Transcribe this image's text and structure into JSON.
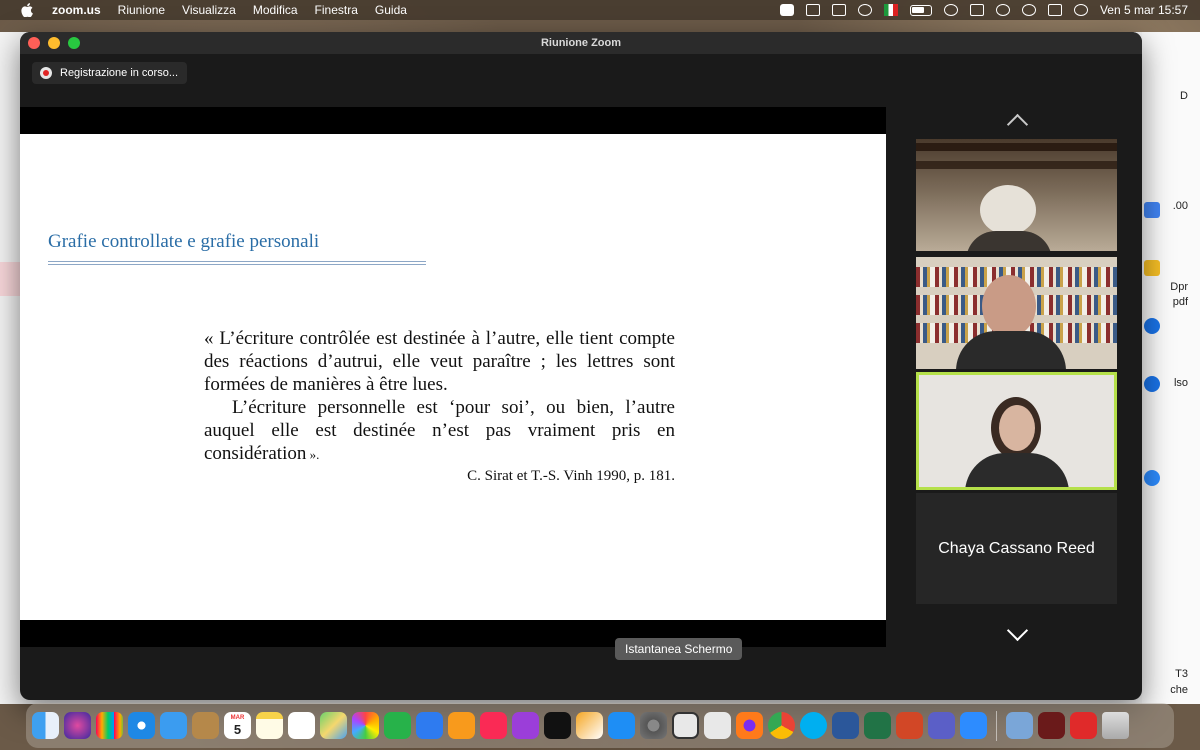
{
  "menubar": {
    "app_name": "zoom.us",
    "menus": [
      "Riunione",
      "Visualizza",
      "Modifica",
      "Finestra",
      "Guida"
    ],
    "clock": "Ven 5 mar  15:57"
  },
  "background_window": {
    "side_texts": [
      "D",
      ".00",
      "Dpr",
      "pdf",
      "lso",
      "che",
      "T3"
    ]
  },
  "window": {
    "title": "Riunione Zoom",
    "recording_label": "Registrazione in corso..."
  },
  "slide": {
    "title": "Grafie controllate e grafie personali",
    "quote_para1": "« L’écriture contrôlée est destinée à l’autre, elle tient compte des réactions d’autrui, elle veut paraître ; les lettres sont formées de manières à être lues.",
    "quote_para2": "L’écriture personnelle est ‘pour soi’, ou bien, l’autre auquel elle est destinée n’est pas vraiment pris en considération",
    "quote_close": " ».",
    "citation": "C. Sirat et T.-S. Vinh 1990, p. 181."
  },
  "gallery": {
    "participant_name": "Chaya Cassano Reed",
    "active_speaker_color": "#b5e04a"
  },
  "tooltip": "Istantanea Schermo",
  "dock": {
    "calendar_month": "MAR",
    "calendar_day": "5",
    "apps": [
      "finder-icon",
      "siri-icon",
      "launchpad-icon",
      "safari-icon",
      "mail-icon",
      "contacts-icon",
      "calendar-icon",
      "notes-icon",
      "reminders-icon",
      "maps-icon",
      "photos-icon",
      "numbers-icon",
      "keynote-icon",
      "books-icon",
      "music-icon",
      "podcasts-icon",
      "tv-icon",
      "pages-icon",
      "app-store-icon",
      "system-preferences-icon",
      "screenshot-icon",
      "acrobat-icon",
      "firefox-icon",
      "chrome-icon",
      "skype-icon",
      "word-icon",
      "excel-icon",
      "powerpoint-icon",
      "teams-icon",
      "zoom-icon",
      "preview-icon",
      "flash-icon",
      "pdf-expert-icon",
      "trash-icon"
    ]
  }
}
